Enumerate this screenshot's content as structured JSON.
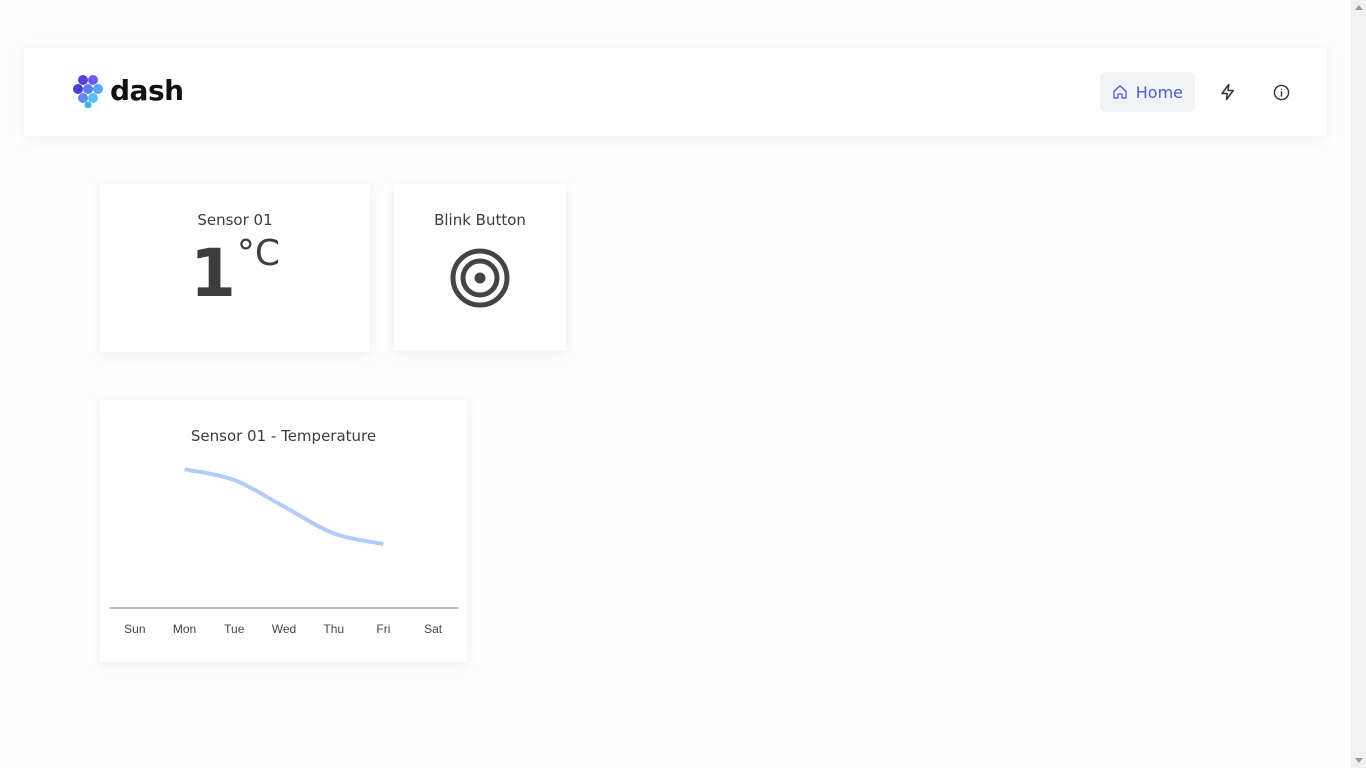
{
  "header": {
    "logo_text": "dash",
    "nav": {
      "home_label": "Home",
      "home_icon": "home-icon",
      "actions_icon": "lightning-icon",
      "info_icon": "info-icon"
    },
    "accent_color": "#4a5ac9"
  },
  "cards": {
    "sensor": {
      "title": "Sensor 01",
      "value": "1",
      "unit": "°C"
    },
    "blink": {
      "title": "Blink Button",
      "icon": "target-icon"
    },
    "chart": {
      "title": "Sensor 01 - Temperature"
    }
  },
  "chart_data": {
    "type": "line",
    "categories": [
      "Sun",
      "Mon",
      "Tue",
      "Wed",
      "Thu",
      "Fri",
      "Sat"
    ],
    "series": [
      {
        "values": [
          null,
          26,
          24,
          19,
          14,
          12,
          null
        ],
        "color": "#b3cdf9"
      }
    ],
    "ylim": [
      0,
      30
    ],
    "grid": false,
    "legend": "none"
  }
}
